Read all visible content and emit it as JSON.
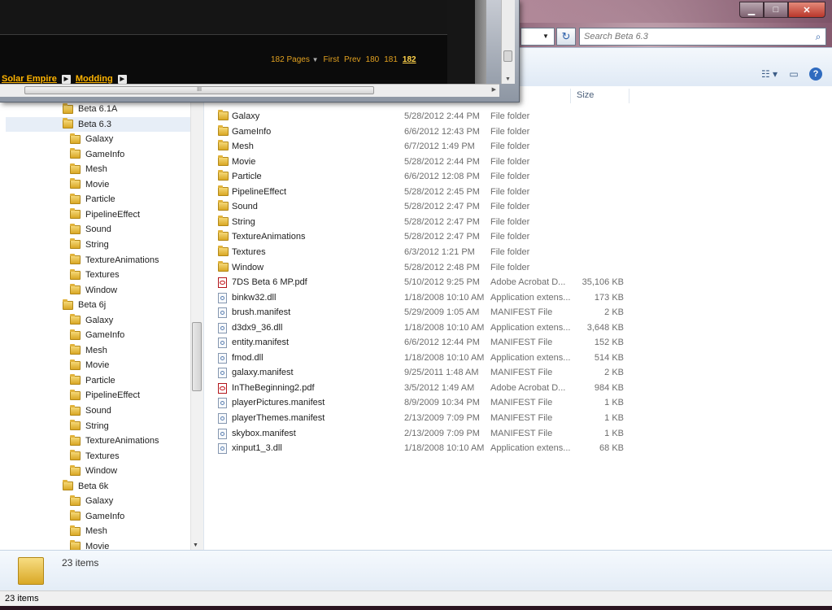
{
  "window": {
    "minimize_glyph": "▁",
    "maximize_glyph": "□",
    "close_glyph": "✕"
  },
  "address": {
    "dropdown_glyph": "▼",
    "refresh_glyph": "↻",
    "search_placeholder": "Search Beta 6.3",
    "search_icon_glyph": "⌕"
  },
  "toolbar": {
    "views_glyph": "☷ ▾",
    "preview_glyph": "▭",
    "help_glyph": "?"
  },
  "nav": {
    "items": [
      {
        "label": "Beta 6.1A",
        "level": 1
      },
      {
        "label": "Beta 6.3",
        "level": 1,
        "selected": true
      },
      {
        "label": "Galaxy",
        "level": 2
      },
      {
        "label": "GameInfo",
        "level": 2
      },
      {
        "label": "Mesh",
        "level": 2
      },
      {
        "label": "Movie",
        "level": 2
      },
      {
        "label": "Particle",
        "level": 2
      },
      {
        "label": "PipelineEffect",
        "level": 2
      },
      {
        "label": "Sound",
        "level": 2
      },
      {
        "label": "String",
        "level": 2
      },
      {
        "label": "TextureAnimations",
        "level": 2
      },
      {
        "label": "Textures",
        "level": 2
      },
      {
        "label": "Window",
        "level": 2
      },
      {
        "label": "Beta 6j",
        "level": 1
      },
      {
        "label": "Galaxy",
        "level": 2
      },
      {
        "label": "GameInfo",
        "level": 2
      },
      {
        "label": "Mesh",
        "level": 2
      },
      {
        "label": "Movie",
        "level": 2
      },
      {
        "label": "Particle",
        "level": 2
      },
      {
        "label": "PipelineEffect",
        "level": 2
      },
      {
        "label": "Sound",
        "level": 2
      },
      {
        "label": "String",
        "level": 2
      },
      {
        "label": "TextureAnimations",
        "level": 2
      },
      {
        "label": "Textures",
        "level": 2
      },
      {
        "label": "Window",
        "level": 2
      },
      {
        "label": "Beta 6k",
        "level": 1
      },
      {
        "label": "Galaxy",
        "level": 2
      },
      {
        "label": "GameInfo",
        "level": 2
      },
      {
        "label": "Mesh",
        "level": 2
      },
      {
        "label": "Movie",
        "level": 2
      }
    ],
    "scroll_down_glyph": "▼"
  },
  "columns": {
    "size": "Size"
  },
  "files": [
    {
      "name": "Galaxy",
      "date": "5/28/2012 2:44 PM",
      "type": "File folder",
      "size": "",
      "icon": "folder"
    },
    {
      "name": "GameInfo",
      "date": "6/6/2012 12:43 PM",
      "type": "File folder",
      "size": "",
      "icon": "folder"
    },
    {
      "name": "Mesh",
      "date": "6/7/2012 1:49 PM",
      "type": "File folder",
      "size": "",
      "icon": "folder"
    },
    {
      "name": "Movie",
      "date": "5/28/2012 2:44 PM",
      "type": "File folder",
      "size": "",
      "icon": "folder"
    },
    {
      "name": "Particle",
      "date": "6/6/2012 12:08 PM",
      "type": "File folder",
      "size": "",
      "icon": "folder"
    },
    {
      "name": "PipelineEffect",
      "date": "5/28/2012 2:45 PM",
      "type": "File folder",
      "size": "",
      "icon": "folder"
    },
    {
      "name": "Sound",
      "date": "5/28/2012 2:47 PM",
      "type": "File folder",
      "size": "",
      "icon": "folder"
    },
    {
      "name": "String",
      "date": "5/28/2012 2:47 PM",
      "type": "File folder",
      "size": "",
      "icon": "folder"
    },
    {
      "name": "TextureAnimations",
      "date": "5/28/2012 2:47 PM",
      "type": "File folder",
      "size": "",
      "icon": "folder"
    },
    {
      "name": "Textures",
      "date": "6/3/2012 1:21 PM",
      "type": "File folder",
      "size": "",
      "icon": "folder"
    },
    {
      "name": "Window",
      "date": "5/28/2012 2:48 PM",
      "type": "File folder",
      "size": "",
      "icon": "folder"
    },
    {
      "name": "7DS Beta 6 MP.pdf",
      "date": "5/10/2012 9:25 PM",
      "type": "Adobe Acrobat D...",
      "size": "35,106 KB",
      "icon": "pdf"
    },
    {
      "name": "binkw32.dll",
      "date": "1/18/2008 10:10 AM",
      "type": "Application extens...",
      "size": "173 KB",
      "icon": "file"
    },
    {
      "name": "brush.manifest",
      "date": "5/29/2009 1:05 AM",
      "type": "MANIFEST File",
      "size": "2 KB",
      "icon": "file"
    },
    {
      "name": "d3dx9_36.dll",
      "date": "1/18/2008 10:10 AM",
      "type": "Application extens...",
      "size": "3,648 KB",
      "icon": "file"
    },
    {
      "name": "entity.manifest",
      "date": "6/6/2012 12:44 PM",
      "type": "MANIFEST File",
      "size": "152 KB",
      "icon": "file"
    },
    {
      "name": "fmod.dll",
      "date": "1/18/2008 10:10 AM",
      "type": "Application extens...",
      "size": "514 KB",
      "icon": "file"
    },
    {
      "name": "galaxy.manifest",
      "date": "9/25/2011 1:48 AM",
      "type": "MANIFEST File",
      "size": "2 KB",
      "icon": "file"
    },
    {
      "name": "InTheBeginning2.pdf",
      "date": "3/5/2012 1:49 AM",
      "type": "Adobe Acrobat D...",
      "size": "984 KB",
      "icon": "pdf"
    },
    {
      "name": "playerPictures.manifest",
      "date": "8/9/2009 10:34 PM",
      "type": "MANIFEST File",
      "size": "1 KB",
      "icon": "file"
    },
    {
      "name": "playerThemes.manifest",
      "date": "2/13/2009 7:09 PM",
      "type": "MANIFEST File",
      "size": "1 KB",
      "icon": "file"
    },
    {
      "name": "skybox.manifest",
      "date": "2/13/2009 7:09 PM",
      "type": "MANIFEST File",
      "size": "1 KB",
      "icon": "file"
    },
    {
      "name": "xinput1_3.dll",
      "date": "1/18/2008 10:10 AM",
      "type": "Application extens...",
      "size": "68 KB",
      "icon": "file"
    }
  ],
  "details": {
    "item_count": "23 items"
  },
  "status": {
    "item_count": "23 items"
  },
  "browser": {
    "pages_label": "182 Pages",
    "pages_dd_glyph": "▼",
    "first": "First",
    "prev": "Prev",
    "page_a": "180",
    "page_b": "181",
    "page_current": "182",
    "crumb_1": "Solar Empire",
    "crumb_2": "Modding",
    "crumb_arrow_glyph": "▶",
    "hscroll_grip": "III",
    "scroll_glyph": "▼",
    "hscroll_right_glyph": "▶"
  }
}
